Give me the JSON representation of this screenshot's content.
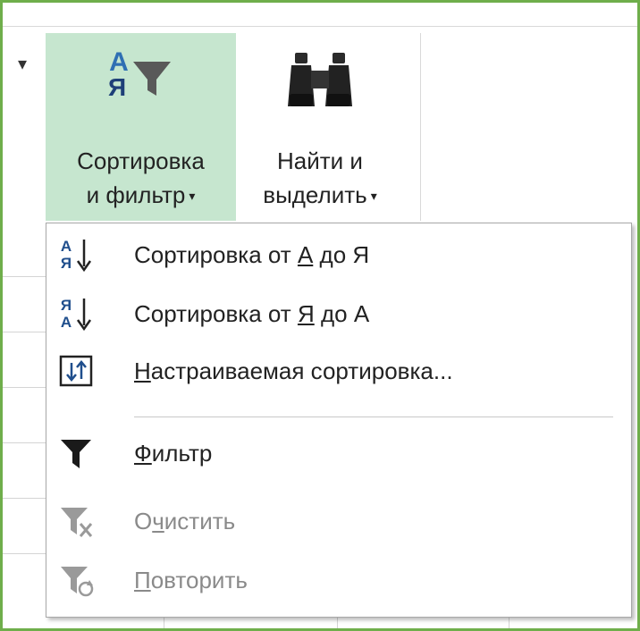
{
  "ribbon": {
    "sort_filter": {
      "line1": "Сортировка",
      "line2": "и фильтр",
      "icon_letter_top": "А",
      "icon_letter_bottom": "Я"
    },
    "find_select": {
      "line1": "Найти и",
      "line2": "выделить"
    }
  },
  "menu": {
    "items": [
      {
        "pre": "Сортировка от ",
        "acc": "А",
        "post": " до Я",
        "icon": "sort-a-to-z-icon",
        "enabled": true,
        "icon_top": "А",
        "icon_bottom": "Я"
      },
      {
        "pre": "Сортировка от ",
        "acc": "Я",
        "post": " до А",
        "icon": "sort-z-to-a-icon",
        "enabled": true,
        "icon_top": "Я",
        "icon_bottom": "А"
      },
      {
        "pre": "",
        "acc": "Н",
        "post": "астраиваемая сортировка...",
        "icon": "custom-sort-icon",
        "enabled": true
      },
      {
        "pre": "",
        "acc": "Ф",
        "post": "ильтр",
        "icon": "filter-icon",
        "enabled": true
      },
      {
        "pre": "О",
        "acc": "ч",
        "post": "истить",
        "icon": "clear-filter-icon",
        "enabled": false
      },
      {
        "pre": "",
        "acc": "П",
        "post": "овторить",
        "icon": "reapply-filter-icon",
        "enabled": false
      }
    ]
  },
  "colors": {
    "frame_border": "#6fae4b",
    "active_button_bg": "#c6e6cf",
    "text": "#222222",
    "disabled_text": "#8a8a8a"
  }
}
